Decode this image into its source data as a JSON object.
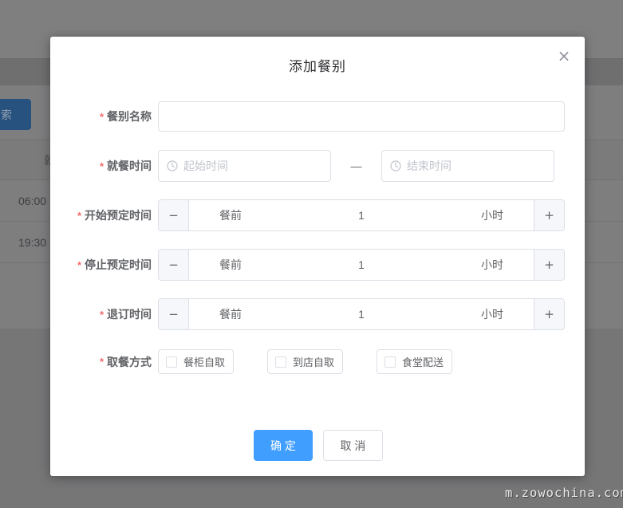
{
  "watermark": "m.zowochina.com",
  "background": {
    "search_button": "搜索",
    "table_header_partial": "就餐时间",
    "row_values": [
      "06:00",
      "19:30"
    ]
  },
  "dialog": {
    "title": "添加餐别",
    "close_glyph": "×",
    "required_mark": "*",
    "name_field": {
      "label": "餐别名称",
      "value": ""
    },
    "time_field": {
      "label": "就餐时间",
      "start_placeholder": "起始时间",
      "end_placeholder": "结束时间",
      "separator": "—"
    },
    "stepper_minus": "−",
    "stepper_plus": "+",
    "steppers": [
      {
        "label": "开始预定时间",
        "prefix": "餐前",
        "value": "1",
        "unit": "小时"
      },
      {
        "label": "停止预定时间",
        "prefix": "餐前",
        "value": "1",
        "unit": "小时"
      },
      {
        "label": "退订时间",
        "prefix": "餐前",
        "value": "1",
        "unit": "小时"
      }
    ],
    "pickup_field": {
      "label": "取餐方式",
      "options": [
        "餐柜自取",
        "到店自取",
        "食堂配送"
      ]
    },
    "footer": {
      "confirm": "确 定",
      "cancel": "取 消"
    }
  },
  "colors": {
    "primary": "#409eff",
    "required": "#f56c6c",
    "border": "#dcdfe6",
    "placeholder": "#c0c4cc",
    "label": "#606266",
    "title": "#303133"
  }
}
